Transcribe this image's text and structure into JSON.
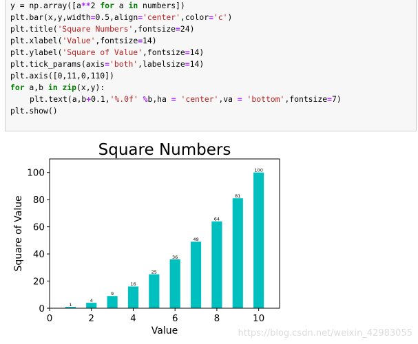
{
  "code_lines": [
    {
      "indent": false,
      "parts": [
        {
          "t": "y = np.array([a",
          "c": "plain"
        },
        {
          "t": "**",
          "c": "op"
        },
        {
          "t": "2 ",
          "c": "plain"
        },
        {
          "t": "for",
          "c": "kw"
        },
        {
          "t": " a ",
          "c": "plain"
        },
        {
          "t": "in",
          "c": "kw"
        },
        {
          "t": " numbers])",
          "c": "plain"
        }
      ]
    },
    {
      "indent": false,
      "parts": [
        {
          "t": "plt.bar(x,y,width",
          "c": "plain"
        },
        {
          "t": "=",
          "c": "op"
        },
        {
          "t": "0.5,align",
          "c": "plain"
        },
        {
          "t": "=",
          "c": "op"
        },
        {
          "t": "'center'",
          "c": "str"
        },
        {
          "t": ",color",
          "c": "plain"
        },
        {
          "t": "=",
          "c": "op"
        },
        {
          "t": "'c'",
          "c": "str"
        },
        {
          "t": ")",
          "c": "plain"
        }
      ]
    },
    {
      "indent": false,
      "parts": [
        {
          "t": "plt.title(",
          "c": "plain"
        },
        {
          "t": "'Square Numbers'",
          "c": "str"
        },
        {
          "t": ",fontsize",
          "c": "plain"
        },
        {
          "t": "=",
          "c": "op"
        },
        {
          "t": "24)",
          "c": "plain"
        }
      ]
    },
    {
      "indent": false,
      "parts": [
        {
          "t": "plt.xlabel(",
          "c": "plain"
        },
        {
          "t": "'Value'",
          "c": "str"
        },
        {
          "t": ",fontsize",
          "c": "plain"
        },
        {
          "t": "=",
          "c": "op"
        },
        {
          "t": "14)",
          "c": "plain"
        }
      ]
    },
    {
      "indent": false,
      "parts": [
        {
          "t": "plt.ylabel(",
          "c": "plain"
        },
        {
          "t": "'Square of Value'",
          "c": "str"
        },
        {
          "t": ",fontsize",
          "c": "plain"
        },
        {
          "t": "=",
          "c": "op"
        },
        {
          "t": "14)",
          "c": "plain"
        }
      ]
    },
    {
      "indent": false,
      "parts": [
        {
          "t": "plt.tick_params(axis",
          "c": "plain"
        },
        {
          "t": "=",
          "c": "op"
        },
        {
          "t": "'both'",
          "c": "str"
        },
        {
          "t": ",labelsize",
          "c": "plain"
        },
        {
          "t": "=",
          "c": "op"
        },
        {
          "t": "14)",
          "c": "plain"
        }
      ]
    },
    {
      "indent": false,
      "parts": [
        {
          "t": "plt.axis([0,11,0,110])",
          "c": "plain"
        }
      ]
    },
    {
      "indent": false,
      "parts": [
        {
          "t": "for",
          "c": "kw"
        },
        {
          "t": " a,b ",
          "c": "plain"
        },
        {
          "t": "in",
          "c": "kw"
        },
        {
          "t": " ",
          "c": "plain"
        },
        {
          "t": "zip",
          "c": "kw"
        },
        {
          "t": "(x,y):",
          "c": "plain"
        }
      ]
    },
    {
      "indent": true,
      "parts": [
        {
          "t": "plt.text(a,b",
          "c": "plain"
        },
        {
          "t": "+",
          "c": "op"
        },
        {
          "t": "0.1,",
          "c": "plain"
        },
        {
          "t": "'%.0f'",
          "c": "str"
        },
        {
          "t": " ",
          "c": "plain"
        },
        {
          "t": "%",
          "c": "op"
        },
        {
          "t": "b,ha ",
          "c": "plain"
        },
        {
          "t": "=",
          "c": "op"
        },
        {
          "t": " ",
          "c": "plain"
        },
        {
          "t": "'center'",
          "c": "str"
        },
        {
          "t": ",va ",
          "c": "plain"
        },
        {
          "t": "=",
          "c": "op"
        },
        {
          "t": " ",
          "c": "plain"
        },
        {
          "t": "'bottom'",
          "c": "str"
        },
        {
          "t": ",fontsize",
          "c": "plain"
        },
        {
          "t": "=",
          "c": "op"
        },
        {
          "t": "7)",
          "c": "plain"
        }
      ]
    },
    {
      "indent": false,
      "parts": [
        {
          "t": "plt.show()",
          "c": "plain"
        }
      ]
    }
  ],
  "chart_data": {
    "type": "bar",
    "title": "Square Numbers",
    "xlabel": "Value",
    "ylabel": "Square of Value",
    "x": [
      1,
      2,
      3,
      4,
      5,
      6,
      7,
      8,
      9,
      10
    ],
    "values": [
      1,
      4,
      9,
      16,
      25,
      36,
      49,
      64,
      81,
      100
    ],
    "value_labels": [
      "1",
      "4",
      "9",
      "16",
      "25",
      "36",
      "49",
      "64",
      "81",
      "100"
    ],
    "bar_width": 0.5,
    "color": "#00bfbf",
    "xlim": [
      0,
      11
    ],
    "ylim": [
      0,
      110
    ],
    "xticks": [
      0,
      2,
      4,
      6,
      8,
      10
    ],
    "xtick_labels": [
      "0",
      "2",
      "4",
      "6",
      "8",
      "10"
    ],
    "yticks": [
      0,
      20,
      40,
      60,
      80,
      100
    ],
    "ytick_labels": [
      "0",
      "20",
      "40",
      "60",
      "80",
      "100"
    ],
    "grid": false
  },
  "watermark": "https://blog.csdn.net/weixin_42983055"
}
